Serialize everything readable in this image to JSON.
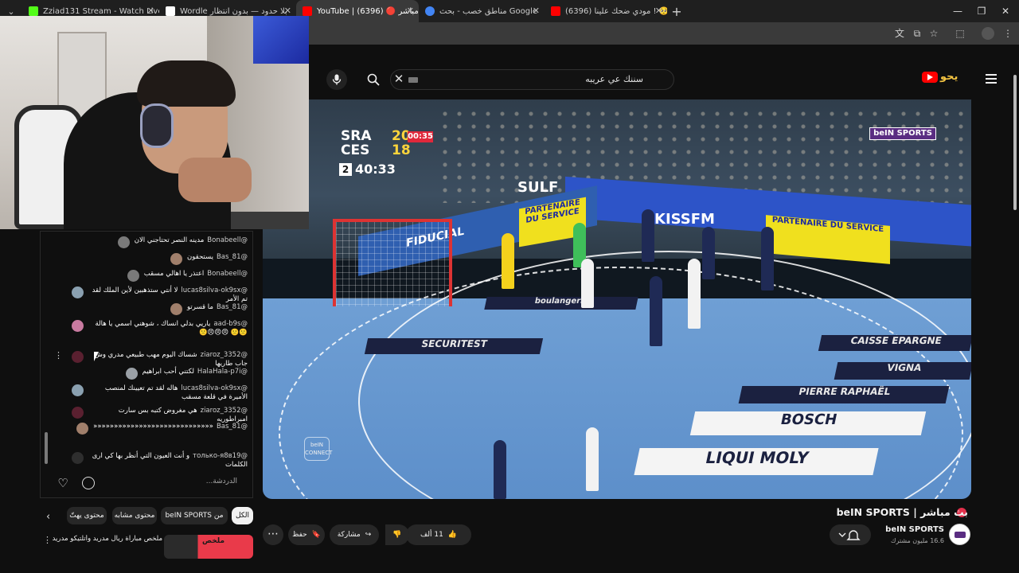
{
  "browser": {
    "tabs": [
      {
        "title": "Zziad131 Stream - Watch Live o",
        "favicon_color": "#53fc18",
        "active": false
      },
      {
        "title": "Wordle بلا حدود — بدون انتظار",
        "favicon_color": "#ffffff",
        "active": false
      },
      {
        "title": "YouTube | بث مباشر 🔴 (6396)",
        "favicon_color": "#ff0000",
        "active": true
      },
      {
        "title": "مناطق خصب - بحث Google",
        "favicon_color": "#4285f4",
        "active": false
      },
      {
        "title": "(6396) مودي ضحك علينا ! 🥺💖",
        "favicon_color": "#ff0000",
        "active": false
      }
    ],
    "new_tab": "+",
    "window_controls": {
      "minimize": "—",
      "maximize": "❐",
      "close": "✕"
    }
  },
  "masthead": {
    "search_value": "سننك عي عريبه",
    "clear_icon": "close-icon",
    "brand": "يحو"
  },
  "stream": {
    "scoreboard": {
      "team1": "SRA",
      "score1": "20",
      "team2": "CES",
      "score2": "18",
      "clock": "00:35",
      "half": "2",
      "game_time": "40:33"
    },
    "broadcaster": "beIN SPORTS",
    "connect_badge": "beIN CONNECT",
    "ads": {
      "sulf": "SULF",
      "fiducial": "FIDUCIAL",
      "kissfm": "KISSFM",
      "partner1": "PARTENAIRE DU SERVICE",
      "partner2": "PARTENAIRE DU SERVICE",
      "securitest": "SECURITEST",
      "liquimoly": "LIQUI MOLY",
      "bosch": "BOSCH",
      "caisse": "CAISSE EPARGNE",
      "vigna": "VIGNA",
      "raphael": "PIERRE RAPHAËL",
      "boulangerie": "boulangerie"
    }
  },
  "chat": {
    "messages": [
      {
        "author": "@Bonabeell",
        "text": "مدينه النصر تحتاجني الان",
        "avatar": "#7a7a7a"
      },
      {
        "author": "@Bas_81",
        "text": "يستحقون",
        "avatar": "#a07f6b"
      },
      {
        "author": "@Bonabeell",
        "text": "اعتذر يا اهالي مسقب",
        "avatar": "#7a7a7a"
      },
      {
        "author": "@lucas8silva-ok9sx",
        "text": "لا أنتي ستذهبين لأين الملك لقد تم الأمر",
        "avatar": "#8aa0b0"
      },
      {
        "author": "@Bas_81",
        "text": "ما قسرتو",
        "avatar": "#a07f6b"
      },
      {
        "author": "@aad-b9s",
        "text": "ياريي بدلي انساك ، شوهني اسمي يا هالة 🙁🙁 😠😠😠🙁",
        "avatar": "#c87aa0"
      },
      {
        "author": "@ziaroz_3352",
        "text": "شساك اليوم مهب طبيعي مدري وش جاب طاريها",
        "avatar": "#5a2030"
      },
      {
        "author": "@HalaHala-p7i",
        "text": "لكتني أحب ابراهيم",
        "avatar": "#9aa0a6"
      },
      {
        "author": "@lucas8silva-ok9sx",
        "text": "هاله لقد تم تعيينك لمنصب الأميرة في قلعة مسقب",
        "avatar": "#8aa0b0"
      },
      {
        "author": "@ziaroz_3352",
        "text": "هي مغروض كتبه بس سارت امبراطوريه",
        "avatar": "#5a2030"
      },
      {
        "author": "@Bas_81",
        "text": "«««««««««««««««««««««««««««««",
        "avatar": "#a07f6b"
      },
      {
        "author": "@только-я8в19",
        "text": "و أنت العيون التي أنظر بها كي ارى الكلمات",
        "avatar": "#2e2e2e"
      }
    ],
    "input_placeholder": "الدردشة..."
  },
  "chips": [
    {
      "label": "الكل",
      "active": true
    },
    {
      "label": "من beIN SPORTS",
      "active": false
    },
    {
      "label": "محتوى مشابه",
      "active": false
    },
    {
      "label": "محتوى يهتّ",
      "active": false
    }
  ],
  "recommended": {
    "title": "ملخص مباراة ريال مدريد وأتلتيكو مدريد (3-",
    "badge": "ملخص"
  },
  "video": {
    "title": "بث مباشر | beIN SPORTS",
    "channel_name": "beIN SPORTS",
    "subscribers": "16.6 مليون مشترك",
    "likes": "11 ألف",
    "share_label": "مشاركة",
    "save_label": "حفظ"
  }
}
